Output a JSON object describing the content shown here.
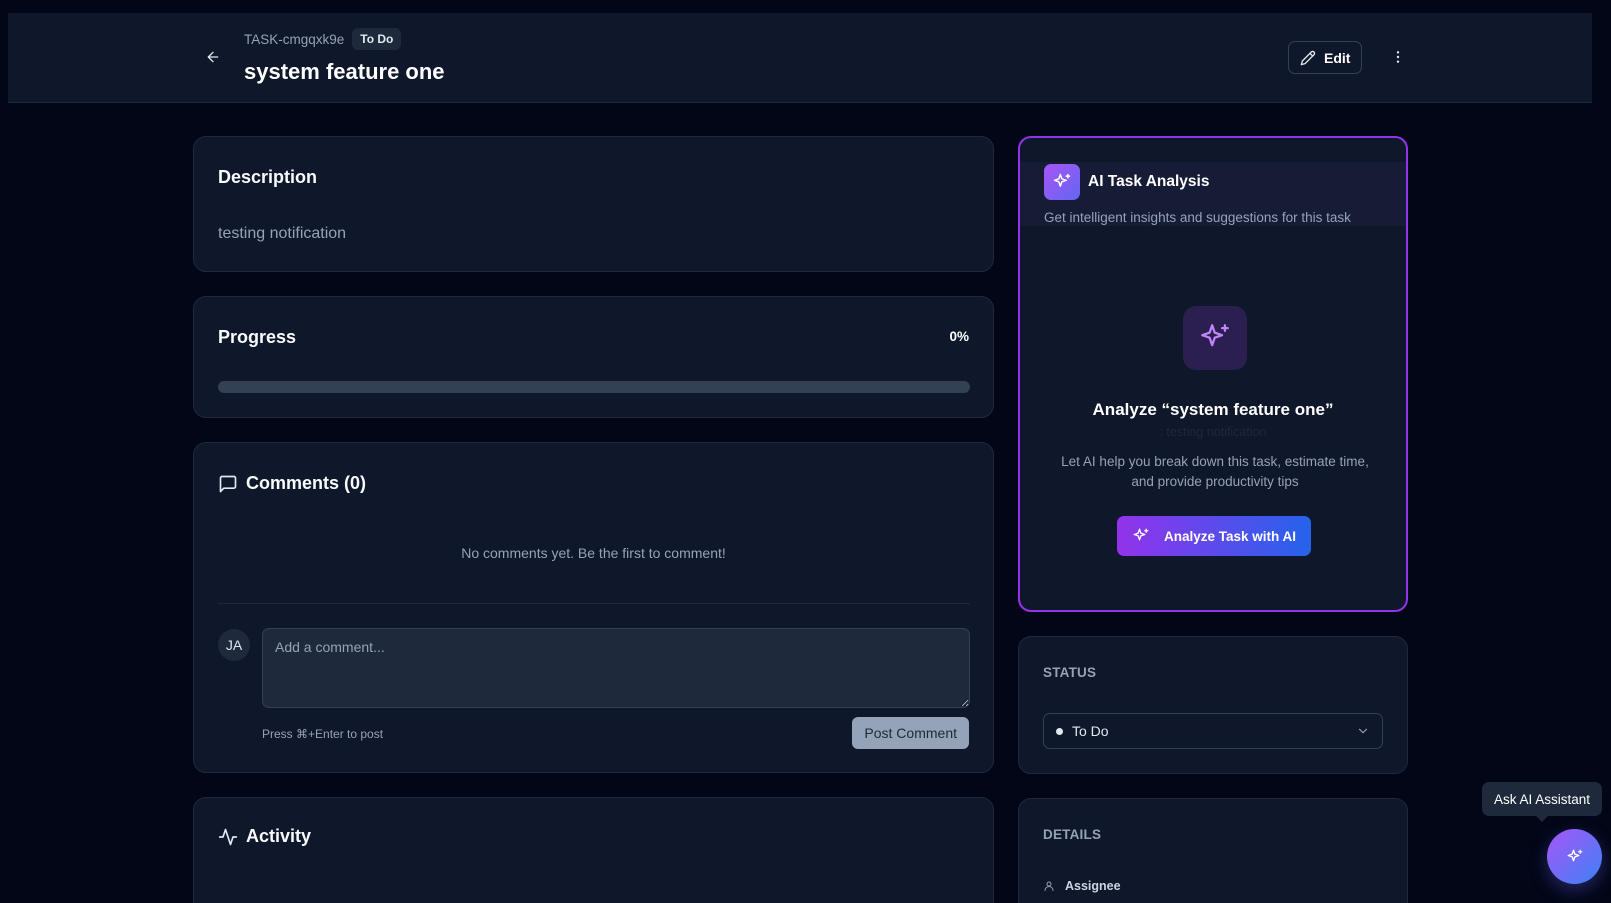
{
  "header": {
    "task_id": "TASK-cmgqxk9e",
    "status_chip": "To Do",
    "title": "system feature one",
    "edit_label": "Edit"
  },
  "description": {
    "title": "Description",
    "text": "testing notification"
  },
  "progress": {
    "title": "Progress",
    "percent_label": "0%",
    "value": 0
  },
  "comments": {
    "title": "Comments (0)",
    "empty_text": "No comments yet. Be the first to comment!",
    "avatar_initials": "JA",
    "input_placeholder": "Add a comment...",
    "hint": "Press ⌘+Enter to post",
    "post_label": "Post Comment"
  },
  "activity": {
    "title": "Activity"
  },
  "ai_panel": {
    "title": "AI Task Analysis",
    "subtitle": "Get intelligent insights and suggestions for this task",
    "analyze_title": "Analyze “system feature one”",
    "analyze_sub": ": testing notification",
    "description": "Let AI help you break down this task, estimate time, and provide productivity tips",
    "button_label": "Analyze Task with AI"
  },
  "status_panel": {
    "label": "STATUS",
    "value": "To Do"
  },
  "details_panel": {
    "label": "DETAILS",
    "assignee_label": "Assignee"
  },
  "fab": {
    "tooltip": "Ask AI Assistant"
  },
  "colors": {
    "background": "#020617",
    "card": "#0f172a",
    "accent_purple": "#9333ea",
    "accent_blue": "#2563eb",
    "muted_text": "#94a3b8"
  }
}
